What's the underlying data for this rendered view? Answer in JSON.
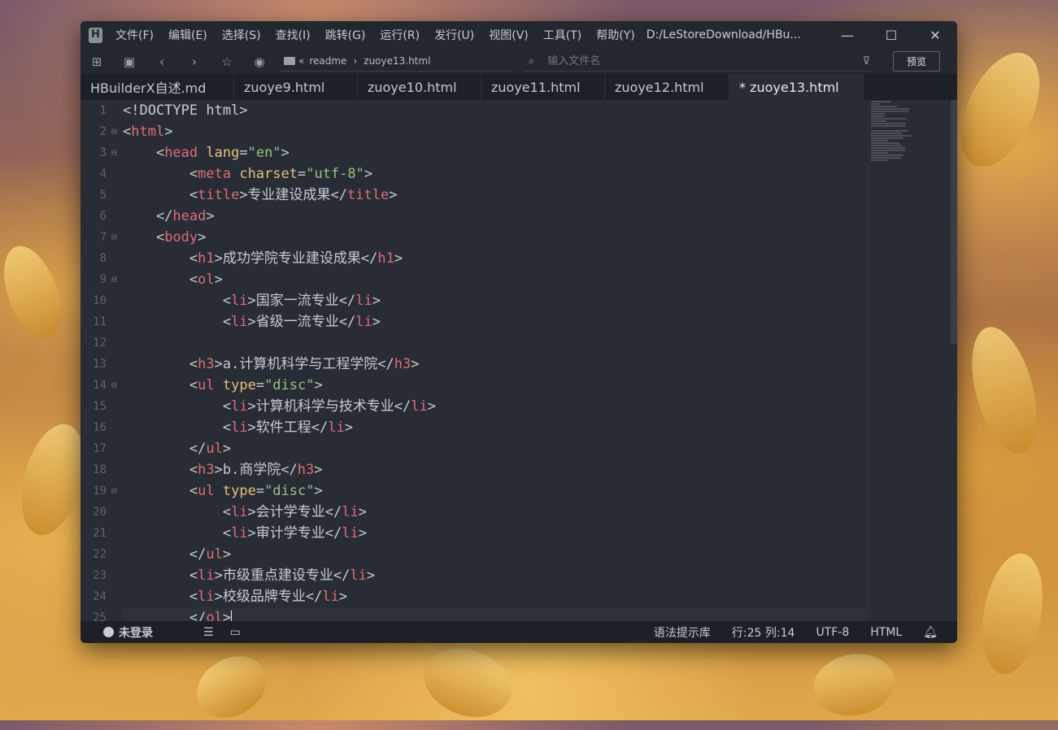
{
  "titlebar": {
    "menus": [
      "文件(F)",
      "编辑(E)",
      "选择(S)",
      "查找(I)",
      "跳转(G)",
      "运行(R)",
      "发行(U)",
      "视图(V)",
      "工具(T)",
      "帮助(Y)"
    ],
    "path": "D:/LeStoreDownload/HBu...",
    "minimize": "—",
    "maximize": "☐",
    "close": "✕"
  },
  "toolbar": {
    "breadcrumb_sep": "«",
    "breadcrumb_1": "readme",
    "breadcrumb_arrow": "›",
    "breadcrumb_2": "zuoye13.html",
    "search_placeholder": "输入文件名",
    "preview_label": "预览"
  },
  "tabs": [
    {
      "label": "HBuilderX自述.md"
    },
    {
      "label": "zuoye9.html"
    },
    {
      "label": "zuoye10.html"
    },
    {
      "label": "zuoye11.html"
    },
    {
      "label": "zuoye12.html"
    },
    {
      "label": "* zuoye13.html"
    }
  ],
  "code_lines": [
    {
      "n": "1",
      "fold": false,
      "tokens": [
        [
          "p",
          "<!DOCTYPE html>"
        ]
      ]
    },
    {
      "n": "2",
      "fold": true,
      "tokens": [
        [
          "p",
          "<"
        ],
        [
          "tag",
          "html"
        ],
        [
          "p",
          ">"
        ]
      ]
    },
    {
      "n": "3",
      "fold": true,
      "tokens": [
        [
          "p",
          "    <"
        ],
        [
          "tag",
          "head"
        ],
        [
          "p",
          " "
        ],
        [
          "attr",
          "lang"
        ],
        [
          "p",
          "="
        ],
        [
          "str",
          "\"en\""
        ],
        [
          "p",
          ">"
        ]
      ]
    },
    {
      "n": "4",
      "fold": false,
      "tokens": [
        [
          "p",
          "        <"
        ],
        [
          "tag",
          "meta"
        ],
        [
          "p",
          " "
        ],
        [
          "attr",
          "charset"
        ],
        [
          "p",
          "="
        ],
        [
          "str",
          "\"utf-8\""
        ],
        [
          "p",
          ">"
        ]
      ]
    },
    {
      "n": "5",
      "fold": false,
      "tokens": [
        [
          "p",
          "        <"
        ],
        [
          "tag",
          "title"
        ],
        [
          "p",
          ">专业建设成果</"
        ],
        [
          "tag",
          "title"
        ],
        [
          "p",
          ">"
        ]
      ]
    },
    {
      "n": "6",
      "fold": false,
      "tokens": [
        [
          "p",
          "    </"
        ],
        [
          "tag",
          "head"
        ],
        [
          "p",
          ">"
        ]
      ]
    },
    {
      "n": "7",
      "fold": true,
      "tokens": [
        [
          "p",
          "    <"
        ],
        [
          "tag",
          "body"
        ],
        [
          "p",
          ">"
        ]
      ]
    },
    {
      "n": "8",
      "fold": false,
      "tokens": [
        [
          "p",
          "        <"
        ],
        [
          "tag",
          "h1"
        ],
        [
          "p",
          ">成功学院专业建设成果</"
        ],
        [
          "tag",
          "h1"
        ],
        [
          "p",
          ">"
        ]
      ]
    },
    {
      "n": "9",
      "fold": true,
      "tokens": [
        [
          "p",
          "        <"
        ],
        [
          "tag",
          "ol"
        ],
        [
          "p",
          ">"
        ]
      ]
    },
    {
      "n": "10",
      "fold": false,
      "tokens": [
        [
          "p",
          "            <"
        ],
        [
          "tag",
          "li"
        ],
        [
          "p",
          ">国家一流专业</"
        ],
        [
          "tag",
          "li"
        ],
        [
          "p",
          ">"
        ]
      ]
    },
    {
      "n": "11",
      "fold": false,
      "tokens": [
        [
          "p",
          "            <"
        ],
        [
          "tag",
          "li"
        ],
        [
          "p",
          ">省级一流专业</"
        ],
        [
          "tag",
          "li"
        ],
        [
          "p",
          ">"
        ]
      ]
    },
    {
      "n": "12",
      "fold": false,
      "tokens": [
        [
          "p",
          ""
        ]
      ]
    },
    {
      "n": "13",
      "fold": false,
      "tokens": [
        [
          "p",
          "        <"
        ],
        [
          "tag",
          "h3"
        ],
        [
          "p",
          ">a.计算机科学与工程学院</"
        ],
        [
          "tag",
          "h3"
        ],
        [
          "p",
          ">"
        ]
      ]
    },
    {
      "n": "14",
      "fold": true,
      "tokens": [
        [
          "p",
          "        <"
        ],
        [
          "tag",
          "ul"
        ],
        [
          "p",
          " "
        ],
        [
          "attr",
          "type"
        ],
        [
          "p",
          "="
        ],
        [
          "str",
          "\"disc\""
        ],
        [
          "p",
          ">"
        ]
      ]
    },
    {
      "n": "15",
      "fold": false,
      "tokens": [
        [
          "p",
          "            <"
        ],
        [
          "tag",
          "li"
        ],
        [
          "p",
          ">计算机科学与技术专业</"
        ],
        [
          "tag",
          "li"
        ],
        [
          "p",
          ">"
        ]
      ]
    },
    {
      "n": "16",
      "fold": false,
      "tokens": [
        [
          "p",
          "            <"
        ],
        [
          "tag",
          "li"
        ],
        [
          "p",
          ">软件工程</"
        ],
        [
          "tag",
          "li"
        ],
        [
          "p",
          ">"
        ]
      ]
    },
    {
      "n": "17",
      "fold": false,
      "tokens": [
        [
          "p",
          "        </"
        ],
        [
          "tag",
          "ul"
        ],
        [
          "p",
          ">"
        ]
      ]
    },
    {
      "n": "18",
      "fold": false,
      "tokens": [
        [
          "p",
          "        <"
        ],
        [
          "tag",
          "h3"
        ],
        [
          "p",
          ">b.商学院</"
        ],
        [
          "tag",
          "h3"
        ],
        [
          "p",
          ">"
        ]
      ]
    },
    {
      "n": "19",
      "fold": true,
      "tokens": [
        [
          "p",
          "        <"
        ],
        [
          "tag",
          "ul"
        ],
        [
          "p",
          " "
        ],
        [
          "attr",
          "type"
        ],
        [
          "p",
          "="
        ],
        [
          "str",
          "\"disc\""
        ],
        [
          "p",
          ">"
        ]
      ]
    },
    {
      "n": "20",
      "fold": false,
      "tokens": [
        [
          "p",
          "            <"
        ],
        [
          "tag",
          "li"
        ],
        [
          "p",
          ">会计学专业</"
        ],
        [
          "tag",
          "li"
        ],
        [
          "p",
          ">"
        ]
      ]
    },
    {
      "n": "21",
      "fold": false,
      "tokens": [
        [
          "p",
          "            <"
        ],
        [
          "tag",
          "li"
        ],
        [
          "p",
          ">审计学专业</"
        ],
        [
          "tag",
          "li"
        ],
        [
          "p",
          ">"
        ]
      ]
    },
    {
      "n": "22",
      "fold": false,
      "tokens": [
        [
          "p",
          "        </"
        ],
        [
          "tag",
          "ul"
        ],
        [
          "p",
          ">"
        ]
      ]
    },
    {
      "n": "23",
      "fold": false,
      "tokens": [
        [
          "p",
          "        <"
        ],
        [
          "tag",
          "li"
        ],
        [
          "p",
          ">市级重点建设专业</"
        ],
        [
          "tag",
          "li"
        ],
        [
          "p",
          ">"
        ]
      ]
    },
    {
      "n": "24",
      "fold": false,
      "tokens": [
        [
          "p",
          "        <"
        ],
        [
          "tag",
          "li"
        ],
        [
          "p",
          ">校级品牌专业</"
        ],
        [
          "tag",
          "li"
        ],
        [
          "p",
          ">"
        ]
      ]
    },
    {
      "n": "25",
      "fold": false,
      "tokens": [
        [
          "p",
          "        </"
        ],
        [
          "tag",
          "ol"
        ],
        [
          "p",
          ">"
        ]
      ]
    }
  ],
  "statusbar": {
    "user": "未登录",
    "syntax": "语法提示库",
    "position": "行:25  列:14",
    "encoding": "UTF-8",
    "language": "HTML"
  },
  "colors": {
    "tag": "#e06c75",
    "attr": "#e5c07b",
    "string": "#98c379",
    "editor_bg": "#282c34"
  }
}
